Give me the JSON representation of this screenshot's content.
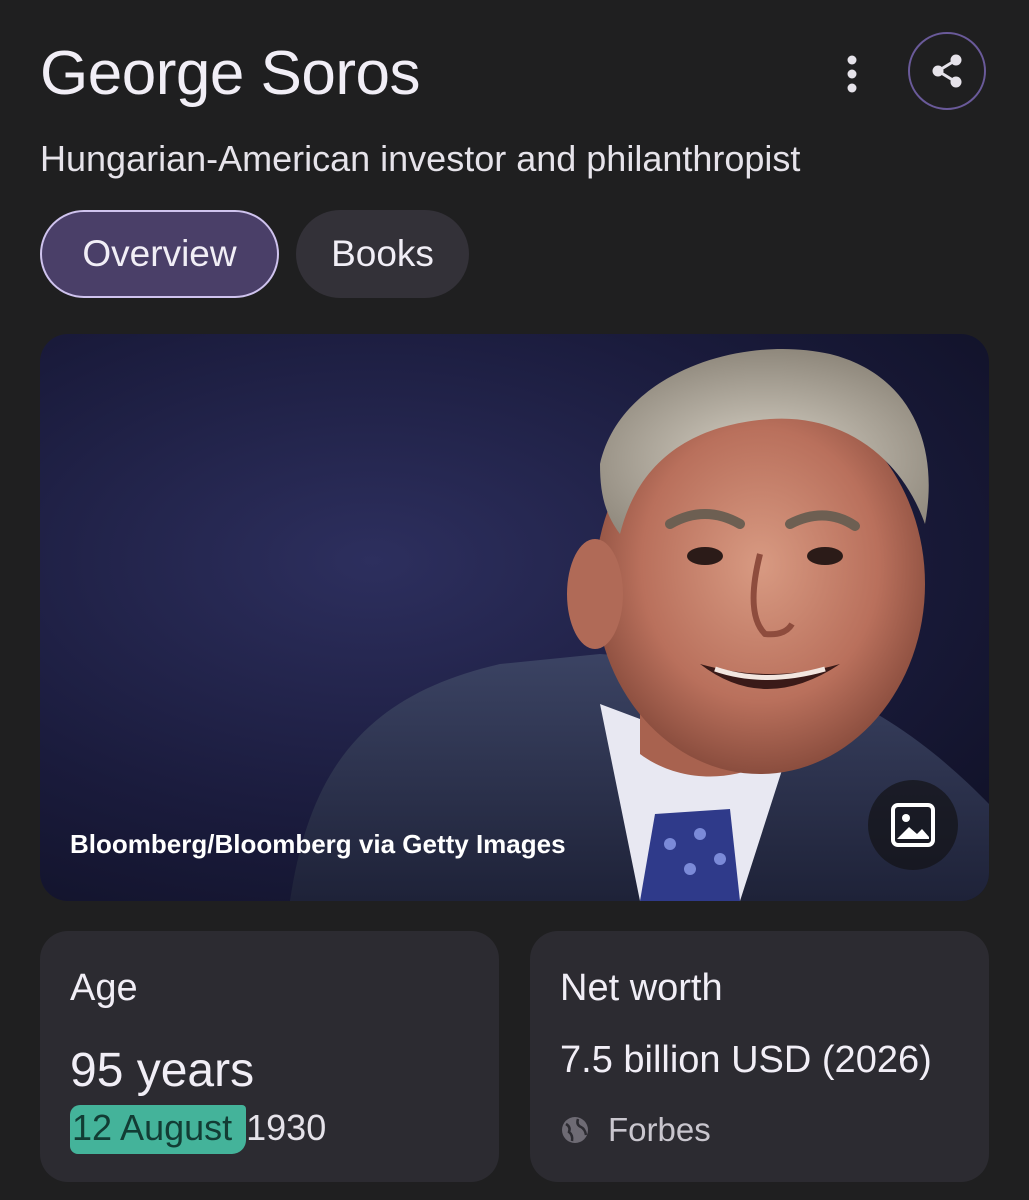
{
  "header": {
    "title": "George Soros",
    "subtitle": "Hungarian-American investor and philanthropist",
    "more_icon": "more-vert-icon",
    "share_icon": "share-icon"
  },
  "tabs": [
    {
      "label": "Overview",
      "selected": true
    },
    {
      "label": "Books",
      "selected": false
    }
  ],
  "photo": {
    "credit": "Bloomberg/Bloomberg via Getty Images",
    "icon": "image-icon"
  },
  "age_card": {
    "label": "Age",
    "value": "95 years",
    "date_highlighted": "12 August ",
    "date_rest": "1930",
    "highlight_color": "#44b39a"
  },
  "worth_card": {
    "label": "Net worth",
    "value": "7.5 billion USD (2026)",
    "source": "Forbes",
    "source_icon": "globe-icon"
  },
  "colors": {
    "background": "#1f1f20",
    "card": "#2c2b31",
    "accent_tab": "#4a3f68",
    "share_ring": "#6a5a9a"
  }
}
